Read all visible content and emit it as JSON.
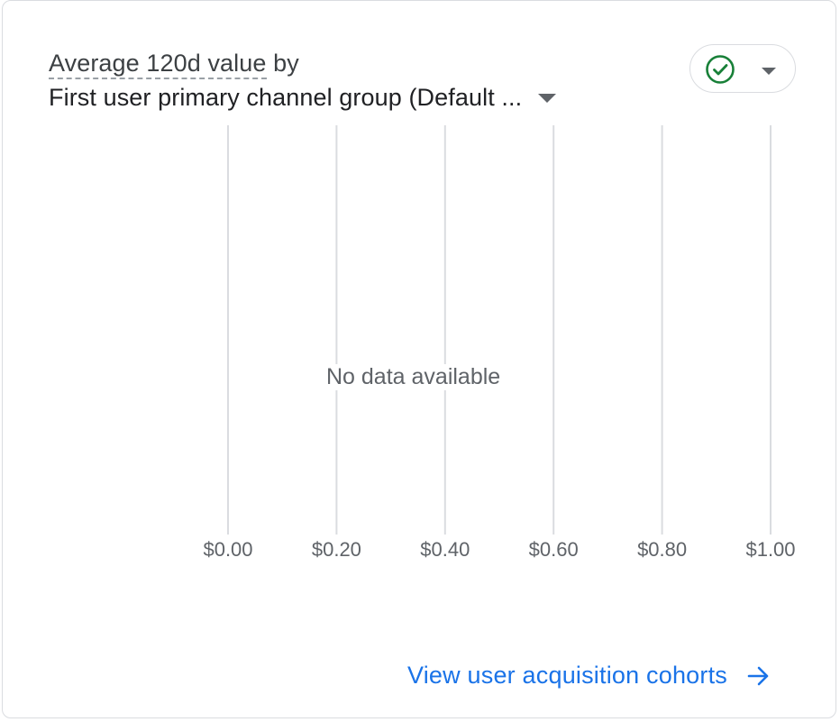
{
  "card": {
    "title": {
      "metric": "Average 120d value",
      "connector": " by",
      "dimension": "First user primary channel group (Default ..."
    },
    "status": {
      "icon": "check-circle-icon",
      "dropdown_icon": "caret-down-icon",
      "color": "#188038"
    },
    "empty_message": "No data available",
    "footer_link": {
      "label": "View user acquisition cohorts",
      "icon": "arrow-right-icon",
      "color": "#1a73e8"
    }
  },
  "chart_data": {
    "type": "bar",
    "orientation": "horizontal",
    "categories": [],
    "values": [],
    "x_ticks": [
      "$0.00",
      "$0.20",
      "$0.40",
      "$0.60",
      "$0.80",
      "$1.00"
    ],
    "xlim": [
      0,
      1
    ],
    "grid": true
  }
}
